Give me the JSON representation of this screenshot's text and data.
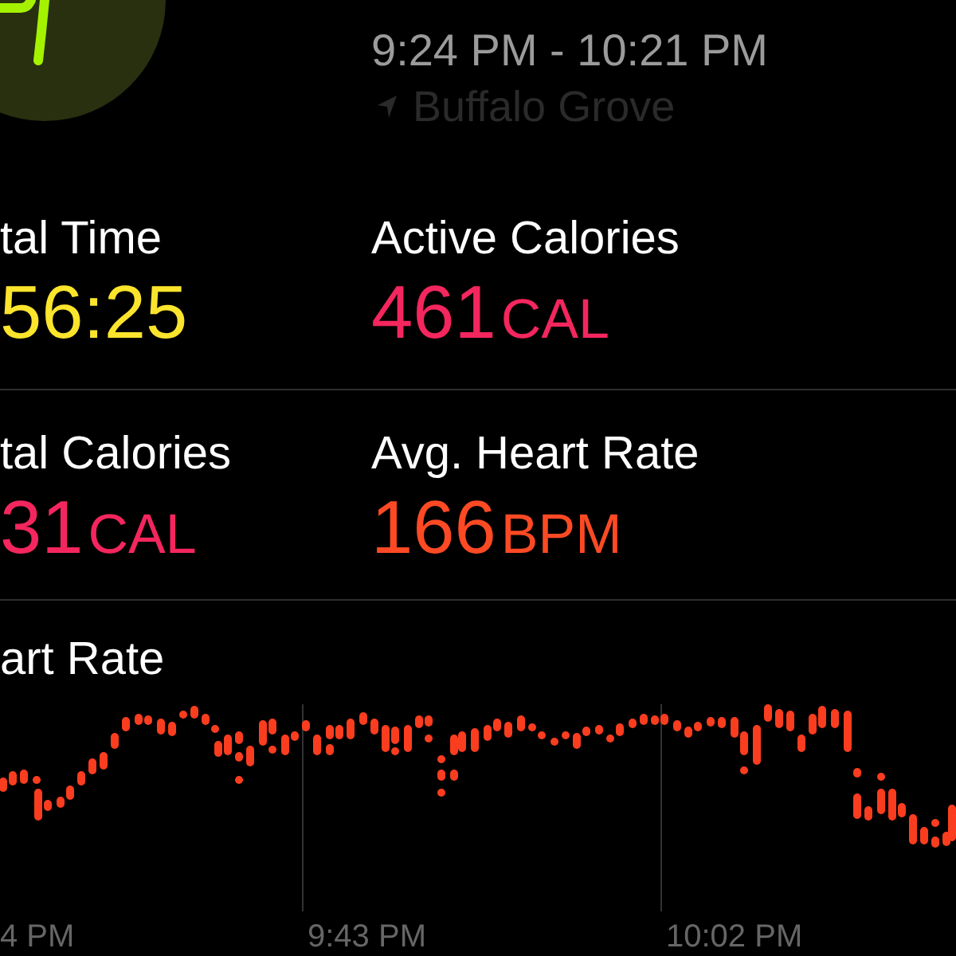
{
  "header": {
    "time_range": "9:24 PM - 10:21 PM",
    "location": "Buffalo Grove"
  },
  "metrics": [
    {
      "label": "tal Time",
      "value": "56:25",
      "color": "#fbe42c"
    },
    {
      "label": "Active Calories",
      "value": "461",
      "unit": "CAL",
      "color": "#f4265e"
    },
    {
      "label": "tal Calories",
      "value": "31",
      "unit": "CAL",
      "color": "#f4265e"
    },
    {
      "label": "Avg. Heart Rate",
      "value": "166",
      "unit": "BPM",
      "color": "#fd4a24"
    }
  ],
  "heart_rate_chart": {
    "title": "art Rate",
    "x_labels": [
      "4 PM",
      "9:43 PM",
      "10:02 PM"
    ]
  }
}
